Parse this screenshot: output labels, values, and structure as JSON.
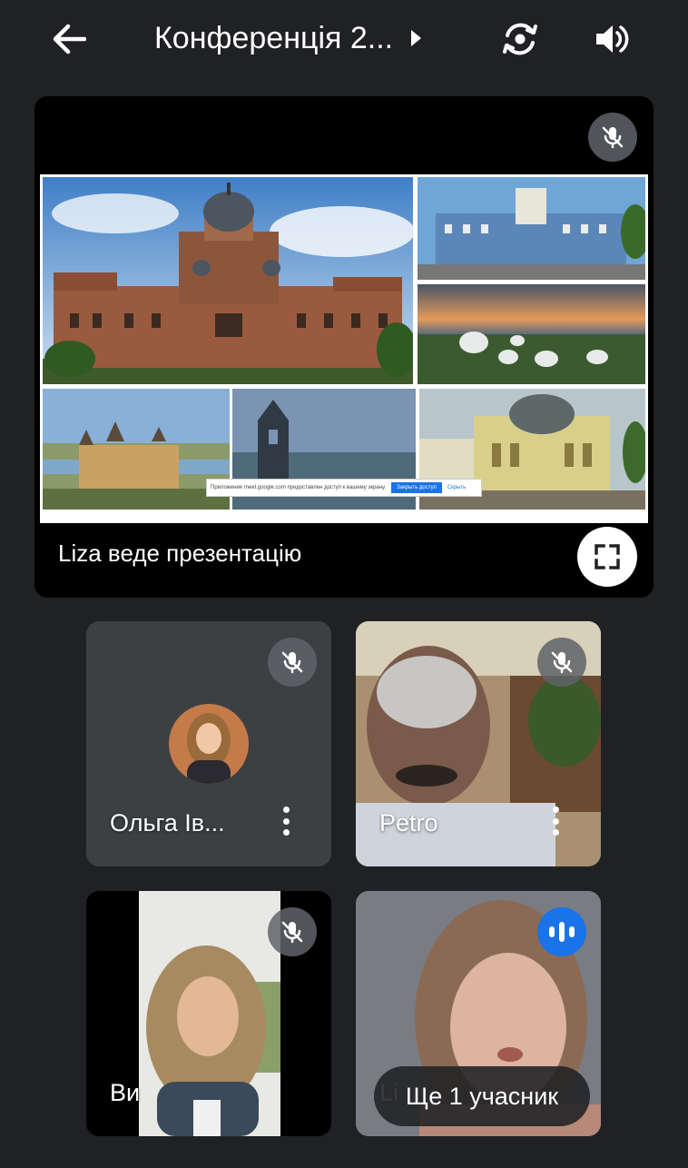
{
  "header": {
    "back_icon": "arrow-left-icon",
    "title": "Конференція 2...",
    "switch_camera_icon": "switch-camera-icon",
    "audio_icon": "speaker-icon"
  },
  "presentation": {
    "label": "Liza веде презентацію",
    "muted": true,
    "notice": {
      "text": "Приложение meet.google.com предоставлен доступ к вашему экрану.",
      "primary_button": "Закрыть доступ",
      "secondary_button": "Скрыть"
    },
    "fullscreen_icon": "fullscreen-icon"
  },
  "participants": [
    {
      "name": "Ольга Ів...",
      "muted": true,
      "camera_off": true,
      "has_menu": true
    },
    {
      "name": "Petro",
      "muted": true,
      "camera_off": false,
      "has_menu": true
    },
    {
      "name": "Ви",
      "muted": true,
      "camera_off": false,
      "has_menu": false
    },
    {
      "name": "Li",
      "muted": false,
      "speaking": true,
      "camera_off": false,
      "has_menu": false
    }
  ],
  "more_participants": "Ще 1 учасник",
  "colors": {
    "background": "#202124",
    "tile": "#3c4043",
    "speaking_accent": "#1a73e8",
    "badge": "#5f6368"
  }
}
